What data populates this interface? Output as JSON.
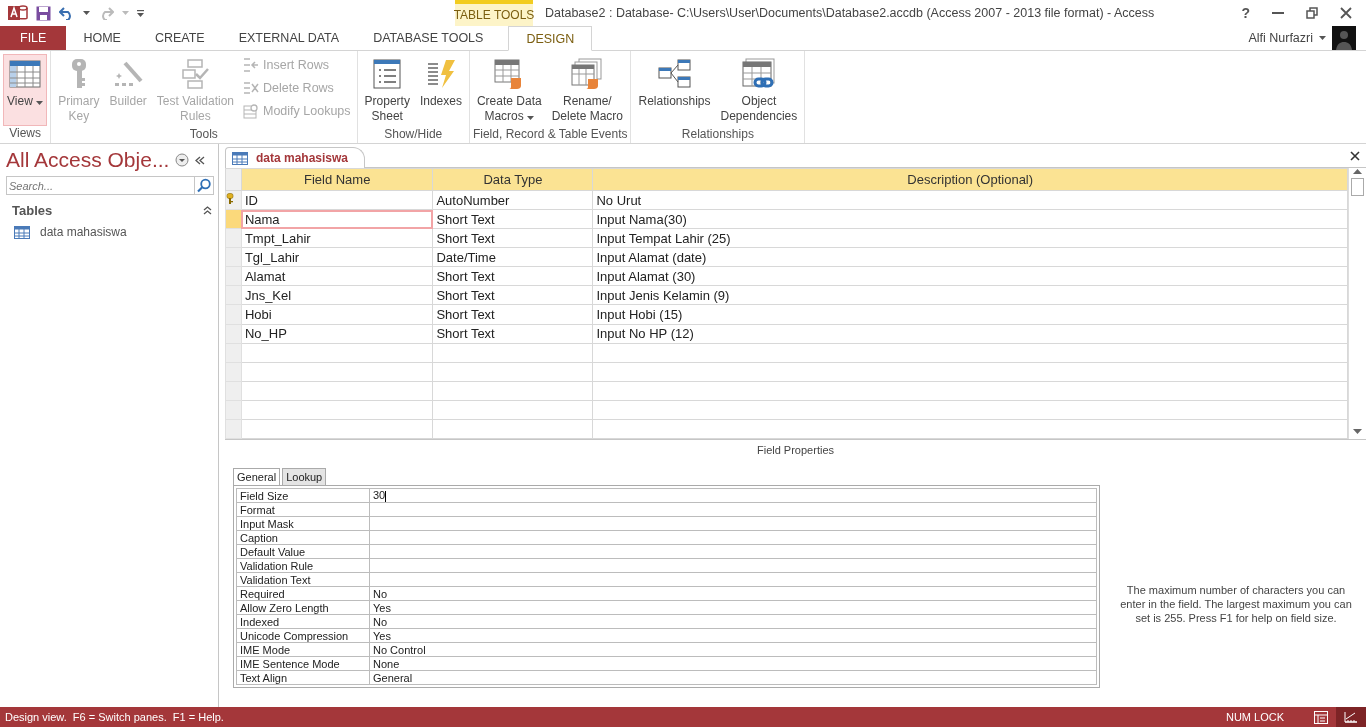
{
  "title_bar": {
    "contextual_group": "TABLE TOOLS",
    "title": "Database2 : Database- C:\\Users\\User\\Documents\\Database2.accdb (Access 2007 - 2013 file format) - Access",
    "help": "?"
  },
  "ribbon_tabs": [
    {
      "label": "FILE",
      "kind": "file",
      "selected": false
    },
    {
      "label": "HOME",
      "kind": "normal",
      "selected": false
    },
    {
      "label": "CREATE",
      "kind": "normal",
      "selected": false
    },
    {
      "label": "EXTERNAL DATA",
      "kind": "normal",
      "selected": false
    },
    {
      "label": "DATABASE TOOLS",
      "kind": "normal",
      "selected": false
    },
    {
      "label": "DESIGN",
      "kind": "contextual",
      "selected": true
    }
  ],
  "account": {
    "user": "Alfi Nurfazri"
  },
  "ribbon_groups": [
    {
      "label": "Views",
      "commands": [
        {
          "label": "View",
          "kind": "large",
          "dropdown": true,
          "disabled": false,
          "pressed": true
        }
      ]
    },
    {
      "label": "Tools",
      "commands": [
        {
          "label": "Primary\nKey",
          "kind": "large",
          "dropdown": false,
          "disabled": true,
          "pressed": false
        },
        {
          "label": "Builder",
          "kind": "large",
          "dropdown": false,
          "disabled": true,
          "pressed": false
        },
        {
          "label": "Test Validation\nRules",
          "kind": "large",
          "dropdown": false,
          "disabled": true,
          "pressed": false
        },
        {
          "label": "Insert Rows",
          "kind": "small",
          "dropdown": false,
          "disabled": true,
          "pressed": false
        },
        {
          "label": "Delete Rows",
          "kind": "small",
          "dropdown": false,
          "disabled": true,
          "pressed": false
        },
        {
          "label": "Modify Lookups",
          "kind": "small",
          "dropdown": false,
          "disabled": true,
          "pressed": false
        }
      ]
    },
    {
      "label": "Show/Hide",
      "commands": [
        {
          "label": "Property\nSheet",
          "kind": "large",
          "dropdown": false,
          "disabled": false,
          "pressed": false
        },
        {
          "label": "Indexes",
          "kind": "large",
          "dropdown": false,
          "disabled": false,
          "pressed": false
        }
      ]
    },
    {
      "label": "Field, Record & Table Events",
      "commands": [
        {
          "label": "Create Data\nMacros",
          "kind": "large",
          "dropdown": true,
          "disabled": false,
          "pressed": false
        },
        {
          "label": "Rename/\nDelete Macro",
          "kind": "large",
          "dropdown": false,
          "disabled": false,
          "pressed": false
        }
      ]
    },
    {
      "label": "Relationships",
      "commands": [
        {
          "label": "Relationships",
          "kind": "large",
          "dropdown": false,
          "disabled": false,
          "pressed": false
        },
        {
          "label": "Object\nDependencies",
          "kind": "large",
          "dropdown": false,
          "disabled": false,
          "pressed": false
        }
      ]
    }
  ],
  "nav_pane": {
    "title": "All Access Obje...",
    "search": {
      "placeholder": "Search..."
    },
    "groups": [
      {
        "label": "Tables",
        "expanded": true,
        "items": [
          {
            "label": "data mahasiswa",
            "selected": false
          }
        ]
      }
    ]
  },
  "document_tab": {
    "label": "data mahasiswa",
    "selected": true
  },
  "table": {
    "columns": [
      "Field Name",
      "Data Type",
      "Description (Optional)"
    ],
    "rows": [
      {
        "field": "ID",
        "type": "AutoNumber",
        "description": "No Urut",
        "primary_key": true,
        "selected": false
      },
      {
        "field": "Nama",
        "type": "Short Text",
        "description": "Input Nama(30)",
        "primary_key": false,
        "selected": true
      },
      {
        "field": "Tmpt_Lahir",
        "type": "Short Text",
        "description": "Input Tempat Lahir (25)",
        "primary_key": false,
        "selected": false
      },
      {
        "field": "Tgl_Lahir",
        "type": "Date/Time",
        "description": "Input Alamat (date)",
        "primary_key": false,
        "selected": false
      },
      {
        "field": "Alamat",
        "type": "Short Text",
        "description": "Input Alamat (30)",
        "primary_key": false,
        "selected": false
      },
      {
        "field": "Jns_Kel",
        "type": "Short Text",
        "description": "Input Jenis Kelamin (9)",
        "primary_key": false,
        "selected": false
      },
      {
        "field": "Hobi",
        "type": "Short Text",
        "description": "Input Hobi (15)",
        "primary_key": false,
        "selected": false
      },
      {
        "field": "No_HP",
        "type": "Short Text",
        "description": "Input No HP (12)",
        "primary_key": false,
        "selected": false
      }
    ]
  },
  "field_properties": {
    "caption": "Field Properties",
    "tabs": [
      {
        "label": "General",
        "selected": true
      },
      {
        "label": "Lookup",
        "selected": false
      }
    ],
    "properties": [
      {
        "name": "Field Size",
        "value": "30",
        "editing": true
      },
      {
        "name": "Format",
        "editing": false
      },
      {
        "name": "Input Mask",
        "editing": false
      },
      {
        "name": "Caption",
        "editing": false
      },
      {
        "name": "Default Value",
        "editing": false
      },
      {
        "name": "Validation Rule",
        "editing": false
      },
      {
        "name": "Validation Text",
        "editing": false
      },
      {
        "name": "Required",
        "value": "No",
        "editing": false
      },
      {
        "name": "Allow Zero Length",
        "value": "Yes",
        "editing": false
      },
      {
        "name": "Indexed",
        "value": "No",
        "editing": false
      },
      {
        "name": "Unicode Compression",
        "value": "Yes",
        "editing": false
      },
      {
        "name": "IME Mode",
        "value": "No Control",
        "editing": false
      },
      {
        "name": "IME Sentence Mode",
        "value": "None",
        "editing": false
      },
      {
        "name": "Text Align",
        "value": "General",
        "editing": false
      }
    ],
    "help_text": "The maximum number of characters you can enter in the field. The largest maximum you can set is 255. Press F1 for help on field size."
  },
  "status_bar": {
    "message": "Design view.  F6 = Switch panes.  F1 = Help.",
    "indicator": "NUM LOCK",
    "views": [
      {
        "kind": "datasheet",
        "selected": false
      },
      {
        "kind": "design",
        "selected": true
      }
    ]
  }
}
